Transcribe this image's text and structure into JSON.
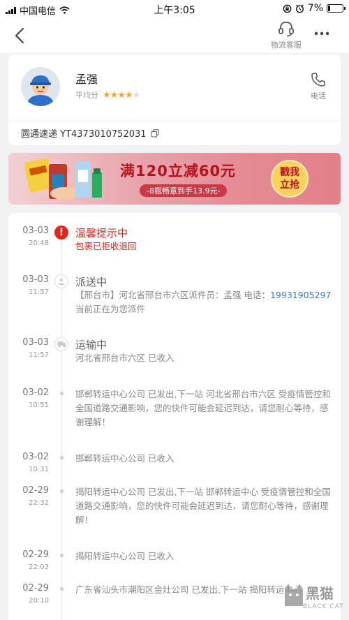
{
  "status_bar": {
    "carrier": "中国电信",
    "time": "上午3:05",
    "battery": "7%"
  },
  "nav": {
    "service_label": "物流客服"
  },
  "courier": {
    "name": "孟强",
    "rating_label": "平均分",
    "rating": 4,
    "rating_max": 5,
    "call_label": "电话",
    "tracking": "圆通速递 YT4373010752031"
  },
  "ad": {
    "headline": "满120立减60元",
    "sub": "-8瓶畅意到手13.9元-",
    "button": "戳我立抢"
  },
  "timeline": [
    {
      "date": "03-03",
      "time": "20:48",
      "status": "温馨提示中",
      "desc": "包裹已拒收退回"
    },
    {
      "date": "03-03",
      "time": "11:57",
      "status": "派送中",
      "desc_prefix": "【邢台市】河北省邢台市六区派件员：孟强 电话：",
      "phone": "19931905297",
      "desc_suffix": " 当前正在为您派件"
    },
    {
      "date": "03-03",
      "time": "11:57",
      "status": "运输中",
      "desc": "河北省邢台市六区 已收入"
    },
    {
      "date": "03-02",
      "time": "10:51",
      "text": "邯郸转运中心公司 已发出,下一站 河北省邢台市六区 受疫情管控和全国道路交通影响，您的快件可能会延迟到达，请您耐心等待，感谢理解！"
    },
    {
      "date": "03-02",
      "time": "10:31",
      "text": "邯郸转运中心公司 已收入"
    },
    {
      "date": "02-29",
      "time": "22:32",
      "text": "揭阳转运中心公司 已发出,下一站 邯郸转运中心 受疫情管控和全国道路交通影响，您的快件可能会延迟到达，请您耐心等待，感谢理解！"
    },
    {
      "date": "02-29",
      "time": "22:03",
      "text": "揭阳转运中心公司 已收入"
    },
    {
      "date": "02-29",
      "time": "20:10",
      "text": "广东省汕头市潮阳区金灶公司 已发出,下一站 揭阳转运中心"
    }
  ],
  "watermark": {
    "title": "黑猫",
    "sub": "BLACK CAT"
  },
  "colors": {
    "alert": "#e3251b",
    "star": "#f5a623",
    "link": "#3a7bd5"
  },
  "icons": [
    "signal-icon",
    "wifi-icon",
    "orientation-lock-icon",
    "alarm-icon",
    "battery-icon",
    "back-arrow-icon",
    "headset-icon",
    "more-dots-icon",
    "phone-icon",
    "copy-icon",
    "alert-icon",
    "person-icon",
    "truck-icon"
  ]
}
